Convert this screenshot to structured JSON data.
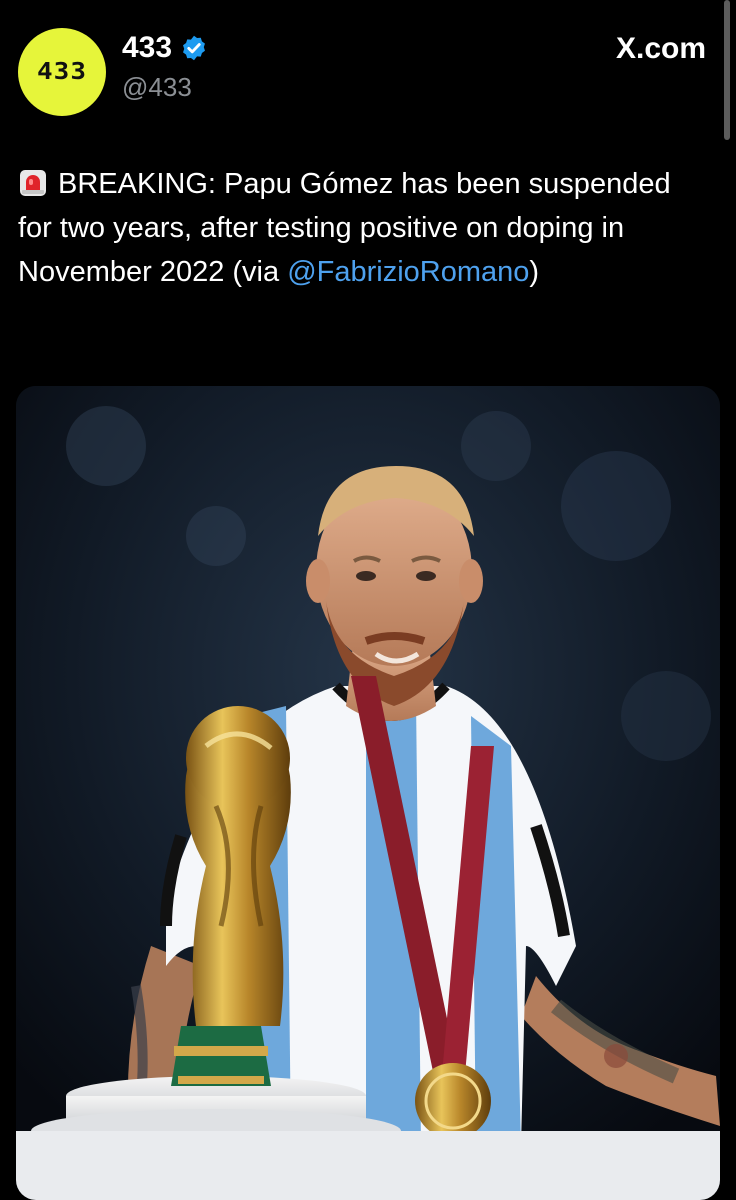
{
  "account": {
    "avatar_text": "433",
    "display_name": "433",
    "handle": "@433",
    "verified": true
  },
  "source_label": "X.com",
  "tweet": {
    "emoji_icon": "police-light-icon",
    "text_main": "BREAKING: Papu Gómez has been suspended for two years, after testing positive on doping in November 2022 (via ",
    "mention": "@FabrizioRomano",
    "text_end": ")"
  },
  "colors": {
    "background": "#000000",
    "avatar_bg": "#e6f53a",
    "verified_blue": "#1d9bf0",
    "link_blue": "#4ea1ee",
    "handle_gray": "#8b8f94"
  }
}
